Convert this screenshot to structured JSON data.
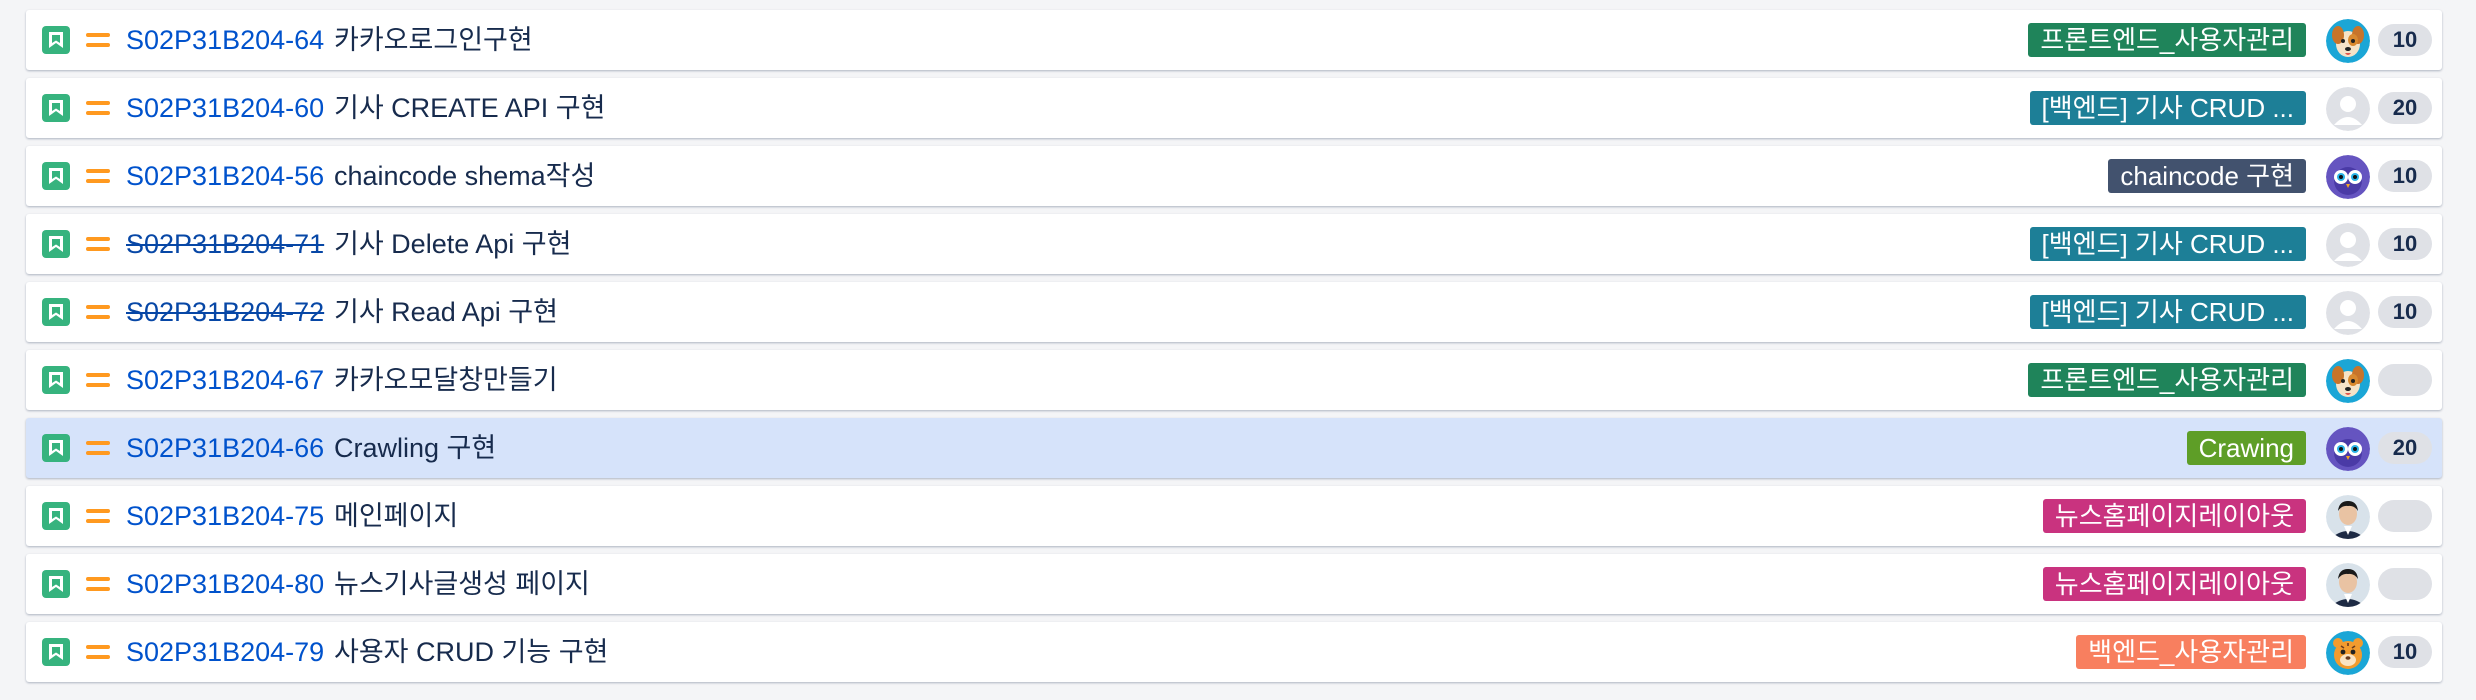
{
  "colors": {
    "story_icon": "#36b37e",
    "priority_medium": "#ff991f",
    "link": "#0052cc",
    "selected_row": "#d6e3fa"
  },
  "issues": [
    {
      "key": "S02P31B204-64",
      "summary": "카카오로그인구현",
      "done": false,
      "epic": "프론트엔드_사용자관리",
      "epic_color": "#1f845a",
      "avatar": "dog-avatar",
      "estimate": "10",
      "selected": false
    },
    {
      "key": "S02P31B204-60",
      "summary": "기사 CREATE API 구현",
      "done": false,
      "epic": "[백엔드] 기사 CRUD ...",
      "epic_color": "#1d7f97",
      "avatar": "default-avatar",
      "estimate": "20",
      "selected": false
    },
    {
      "key": "S02P31B204-56",
      "summary": "chaincode shema작성",
      "done": false,
      "epic": "chaincode 구현",
      "epic_color": "#42526e",
      "avatar": "owl-avatar",
      "estimate": "10",
      "selected": false
    },
    {
      "key": "S02P31B204-71",
      "summary": "기사 Delete Api 구현",
      "done": true,
      "epic": "[백엔드] 기사 CRUD ...",
      "epic_color": "#1d7f97",
      "avatar": "default-avatar",
      "estimate": "10",
      "selected": false
    },
    {
      "key": "S02P31B204-72",
      "summary": "기사 Read Api 구현",
      "done": true,
      "epic": "[백엔드] 기사 CRUD ...",
      "epic_color": "#1d7f97",
      "avatar": "default-avatar",
      "estimate": "10",
      "selected": false
    },
    {
      "key": "S02P31B204-67",
      "summary": "카카오모달창만들기",
      "done": false,
      "epic": "프론트엔드_사용자관리",
      "epic_color": "#1f845a",
      "avatar": "dog-avatar",
      "estimate": "",
      "selected": false
    },
    {
      "key": "S02P31B204-66",
      "summary": "Crawling 구현",
      "done": false,
      "epic": "Crawing",
      "epic_color": "#5e9e27",
      "avatar": "owl-avatar",
      "estimate": "20",
      "selected": true
    },
    {
      "key": "S02P31B204-75",
      "summary": "메인페이지",
      "done": false,
      "epic": "뉴스홈페이지레이아웃",
      "epic_color": "#c9337f",
      "avatar": "person-avatar",
      "estimate": "",
      "selected": false
    },
    {
      "key": "S02P31B204-80",
      "summary": "뉴스기사글생성 페이지",
      "done": false,
      "epic": "뉴스홈페이지레이아웃",
      "epic_color": "#c9337f",
      "avatar": "person-avatar",
      "estimate": "",
      "selected": false
    },
    {
      "key": "S02P31B204-79",
      "summary": "사용자 CRUD 기능 구현",
      "done": false,
      "epic": "백엔드_사용자관리",
      "epic_color": "#f87f5f",
      "avatar": "tiger-avatar",
      "estimate": "10",
      "selected": false
    }
  ]
}
